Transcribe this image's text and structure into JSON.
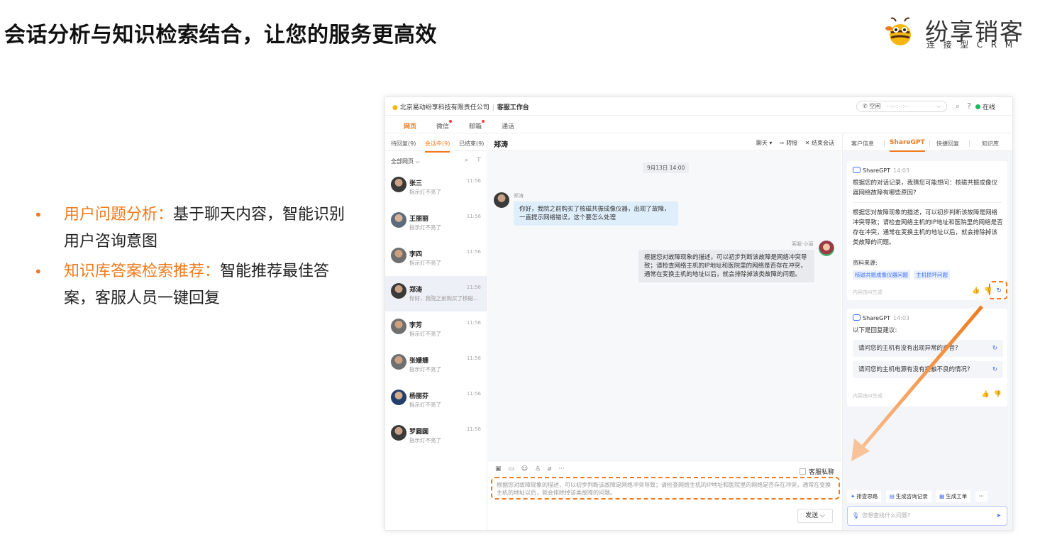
{
  "slide": {
    "title": "会话分析与知识检索结合，让您的服务更高效",
    "logo": {
      "name": "纷享销客",
      "sub": "连接型CRM"
    },
    "bullets": [
      {
        "key": "用户问题分析：",
        "text": "基于聊天内容，智能识别用户咨询意图"
      },
      {
        "key": "知识库答案检索推荐：",
        "text": "智能推荐最佳答案，客服人员一键回复"
      }
    ],
    "accent": "#f07a1c"
  },
  "app": {
    "company": "北京易动纷享科技有限责任公司",
    "workspace": "客服工作台",
    "status": {
      "label": "空闲",
      "dots": "--:--:--:--"
    },
    "online": "在线",
    "channels": [
      "网页",
      "微信",
      "邮箱",
      "通话"
    ],
    "left": {
      "tabs": [
        "待回复(9)",
        "会话中(9)",
        "已结束(9)"
      ],
      "filter": "全部网页",
      "conversations": [
        {
          "name": "张三",
          "time": "11:56",
          "preview": "指示灯不亮了"
        },
        {
          "name": "王丽丽",
          "time": "11:56",
          "preview": "指示灯不亮了"
        },
        {
          "name": "李四",
          "time": "11:56",
          "preview": "指示灯不亮了"
        },
        {
          "name": "郑涛",
          "time": "11:56",
          "preview": "你好，我院之前购买了核磁..."
        },
        {
          "name": "李芳",
          "time": "11:56",
          "preview": "指示灯不亮了"
        },
        {
          "name": "张姗姗",
          "time": "11:56",
          "preview": "指示灯不亮了"
        },
        {
          "name": "杨丽芬",
          "time": "11:56",
          "preview": "指示灯不亮了"
        },
        {
          "name": "罗圆圆",
          "time": "11:56",
          "preview": "指示灯不亮了"
        }
      ]
    },
    "chat": {
      "title": "郑涛",
      "actions": [
        "聊天 ▾",
        "⇨ 转接",
        "✕ 结束会话"
      ],
      "date": "9月13日 14:00",
      "customer_name": "郑涛",
      "customer_msg": "你好，我院之前购买了核磁共振成像仪器，出现了故障，一直提示网络错误，这个要怎么处理",
      "agent_name": "客服-小丽",
      "agent_msg": "根据您对故障现象的描述，可以初步判断该故障是网络冲突导致；请检查网络主机的IP地址和医院里的网络是否存在冲突，通常在变换主机的地址以后，就会排除掉该类故障的问题。",
      "private_label": "客服私聊",
      "draft": "根据您对故障现象的描述，可以初步判断该故障是网络冲突导致；请检查网络主机的IP地址和医院里的网络是否存在冲突，通常在变换主机的地址以后，就会排除掉该类故障的问题。",
      "send": "发送 ⌵"
    },
    "right": {
      "tabs": [
        "客户信息",
        "ShareGPT",
        "快捷回复",
        "知识库"
      ],
      "card1": {
        "bot": "ShareGPT",
        "time": "14:03",
        "intent": "根据您的对话记录，我猜您可能想问：核磁共振成像仪器网络故障有哪些原因?",
        "answer": "根据您对故障现象的描述，可以初步判断该故障是网络冲突导致；请检查网络主机的IP地址和医院里的网络是否存在冲突，通常在变换主机的地址以后，就会排除掉该类故障的问题。",
        "source_label": "资料来源:",
        "sources": [
          "核磁共振成像仪器问题",
          "主机损坏问题"
        ],
        "ai_note": "内容由AI生成"
      },
      "card2": {
        "bot": "ShareGPT",
        "time": "14:03",
        "lead": "以下是回复建议:",
        "suggestions": [
          "请问您的主机有没有出现异常的声音?",
          "请问您的主机电源有没有接触不良的情况?"
        ],
        "ai_note": "内容由AI生成"
      },
      "quick_actions": [
        "排查思路",
        "生成咨询记录",
        "生成工单"
      ],
      "more": "···",
      "ask_placeholder": "您想查找什么问题?"
    }
  }
}
